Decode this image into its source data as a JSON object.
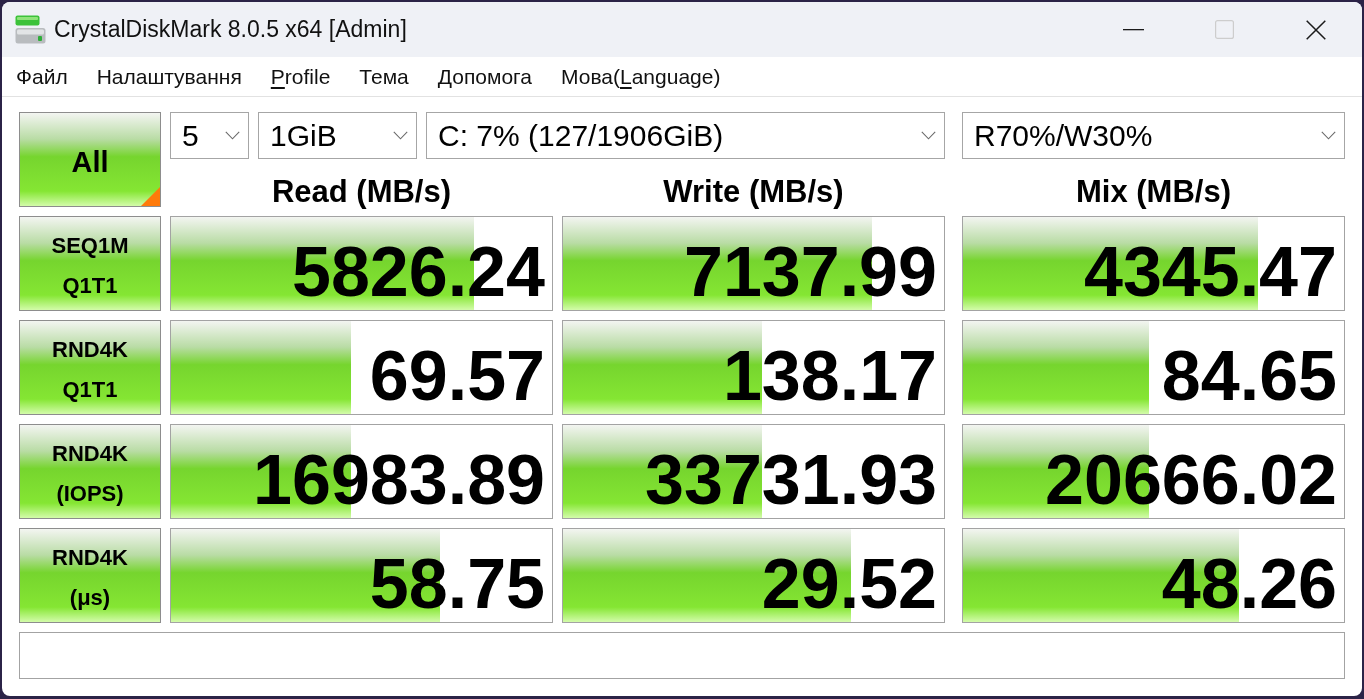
{
  "window": {
    "title": "CrystalDiskMark 8.0.5 x64 [Admin]",
    "buttons": [
      {
        "kind": "minimize",
        "disabled": false
      },
      {
        "kind": "maximize",
        "disabled": true
      },
      {
        "kind": "close",
        "disabled": false
      }
    ]
  },
  "menu": [
    {
      "label": "Файл"
    },
    {
      "label": "Налаштування"
    },
    {
      "access_key": "P",
      "label_end": "rofile"
    },
    {
      "label": "Тема"
    },
    {
      "label": "Допомога"
    },
    {
      "label_start": "Мова(",
      "access_key": "L",
      "label_end": "anguage)"
    }
  ],
  "all_button": {
    "label": "All"
  },
  "selectors": [
    {
      "value": "5"
    },
    {
      "value": "1GiB"
    },
    {
      "value": "C: 7% (127/1906GiB)"
    },
    {
      "value": "R70%/W30%"
    }
  ],
  "columns": [
    "Read (MB/s)",
    "Write (MB/s)",
    "Mix (MB/s)"
  ],
  "rows": [
    {
      "label": [
        "SEQ1M",
        "Q1T1"
      ],
      "cells": [
        {
          "value": "5826.24",
          "level": 0.795
        },
        {
          "value": "7137.99",
          "level": 0.81
        },
        {
          "value": "4345.47",
          "level": 0.775
        }
      ]
    },
    {
      "label": [
        "RND4K",
        "Q1T1"
      ],
      "cells": [
        {
          "value": "69.57",
          "level": 0.472
        },
        {
          "value": "138.17",
          "level": 0.522
        },
        {
          "value": "84.65",
          "level": 0.488
        }
      ]
    },
    {
      "label": [
        "RND4K",
        "(IOPS)"
      ],
      "cells": [
        {
          "value": "16983.89",
          "level": 0.472
        },
        {
          "value": "33731.93",
          "level": 0.522
        },
        {
          "value": "20666.02",
          "level": 0.488
        }
      ]
    },
    {
      "label": [
        "RND4K",
        "(μs)"
      ],
      "cells": [
        {
          "value": "58.75",
          "level": 0.706
        },
        {
          "value": "29.52",
          "level": 0.756
        },
        {
          "value": "48.26",
          "level": 0.724
        }
      ]
    }
  ]
}
